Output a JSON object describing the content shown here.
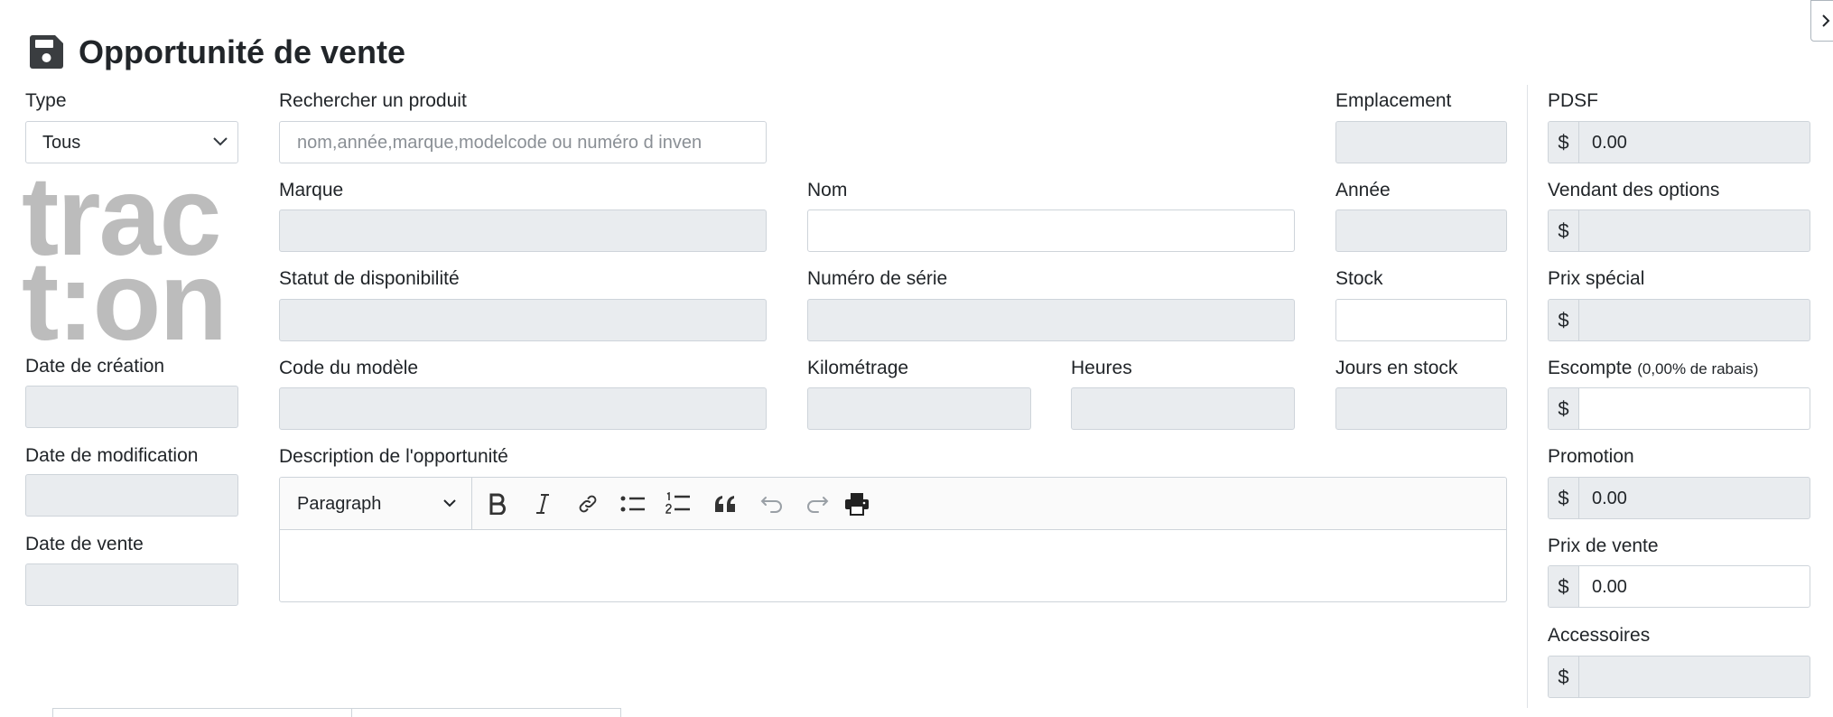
{
  "page": {
    "title": "Opportunité de vente"
  },
  "type": {
    "label": "Type",
    "value": "Tous"
  },
  "logo": {
    "line1": "trac",
    "line2": "t:on"
  },
  "dates": {
    "created_label": "Date de création",
    "modified_label": "Date de modification",
    "sale_label": "Date de vente"
  },
  "product": {
    "search_label": "Rechercher un produit",
    "search_placeholder": "nom,année,marque,modelcode ou numéro d inven",
    "brand_label": "Marque",
    "name_label": "Nom",
    "availability_label": "Statut de disponibilité",
    "serial_label": "Numéro de série",
    "model_code_label": "Code du modèle",
    "mileage_label": "Kilométrage",
    "hours_label": "Heures",
    "location_label": "Emplacement",
    "year_label": "Année",
    "stock_label": "Stock",
    "days_in_stock_label": "Jours en stock",
    "description_label": "Description de l'opportunité"
  },
  "editor": {
    "paragraph": "Paragraph"
  },
  "pricing": {
    "currency": "$",
    "msrp_label": "PDSF",
    "msrp_value": "0.00",
    "options_seller_label": "Vendant des options",
    "special_price_label": "Prix spécial",
    "discount_label": "Escompte",
    "discount_note": "(0,00% de rabais)",
    "promotion_label": "Promotion",
    "promotion_value": "0.00",
    "sale_price_label": "Prix de vente",
    "sale_price_value": "0.00",
    "accessories_label": "Accessoires"
  },
  "colors": {
    "disabled_bg": "#e9ecef",
    "border": "#ced4da",
    "logo_gray": "#bcbcbc"
  }
}
